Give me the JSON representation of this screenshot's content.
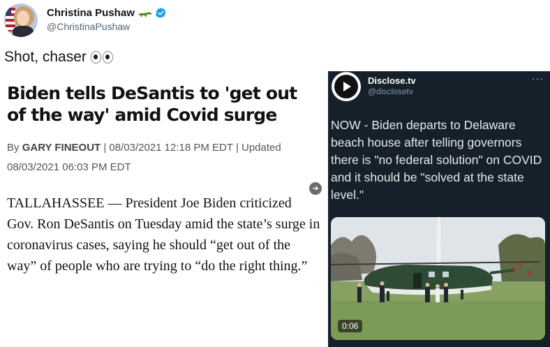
{
  "tweet": {
    "display_name": "Christina Pushaw",
    "handle": "@ChristinaPushaw",
    "text": "Shot, chaser",
    "icons": [
      "crocodile-emoji-icon",
      "verified-badge-icon",
      "eyes-emoji-icon"
    ]
  },
  "article": {
    "headline": "Biden tells DeSantis to 'get out of the way' amid Covid surge",
    "byline_prefix": "By ",
    "author": "GARY FINEOUT",
    "byline_rest": " | 08/03/2021 12:18 PM EDT | Updated 08/03/2021 06:03 PM EDT",
    "body": "TALLAHASSEE — President Joe Biden criticized Gov. Ron DeSantis on Tuesday amid the state’s surge in coronavirus cases, saying he should “get out of the way” of people who are trying to “do the right thing.”"
  },
  "embedded": {
    "name": "Disclose.tv",
    "handle": "@disclosetv",
    "more": "···",
    "text": "NOW - Biden departs to Delaware beach house after telling governors there is \"no federal solution\" on COVID and it should be \"solved at the state level.\"",
    "video_duration": "0:06"
  },
  "colors": {
    "embedded_bg": "#15202b",
    "verified": "#1d9bf0",
    "helicopter": "#2f4a35"
  }
}
